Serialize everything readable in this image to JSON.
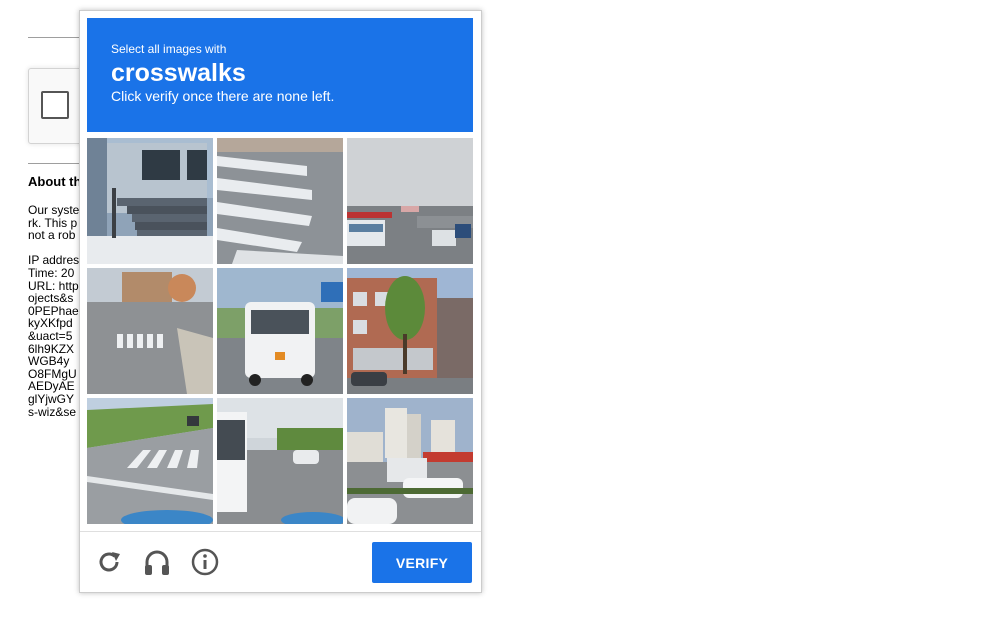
{
  "background_page": {
    "about_heading": "About th",
    "about_body": "Our syste\nrk. This p\nnot a rob\n\nIP addres\nTime: 20\nURL: http\nojects&s\n0PEPhae\nkyXKfpd\n&uact=5\n6lh9KZX\nWGB4y\nO8FMgU\nAEDyAE\nglYjwGY\ns-wiz&se"
  },
  "challenge": {
    "prompt_line": "Select all images with",
    "keyword": "crosswalks",
    "instructions": "Click verify once there are none left.",
    "tiles": [
      {
        "id": 1,
        "scene": "building-entrance-steps"
      },
      {
        "id": 2,
        "scene": "crosswalk-stripes-closeup"
      },
      {
        "id": 3,
        "scene": "highway-traffic-bus"
      },
      {
        "id": 4,
        "scene": "street-with-crosswalk"
      },
      {
        "id": 5,
        "scene": "white-bus-on-road"
      },
      {
        "id": 6,
        "scene": "apartment-building-tree"
      },
      {
        "id": 7,
        "scene": "road-crosswalk-hill"
      },
      {
        "id": 8,
        "scene": "road-with-bus-side"
      },
      {
        "id": 9,
        "scene": "city-buildings-parked-cars"
      }
    ],
    "footer": {
      "reload_icon": "reload-icon",
      "audio_icon": "headphones-icon",
      "info_icon": "info-icon",
      "verify_label": "VERIFY"
    }
  },
  "colors": {
    "accent": "#1a73e8",
    "icon_gray": "#555555"
  }
}
